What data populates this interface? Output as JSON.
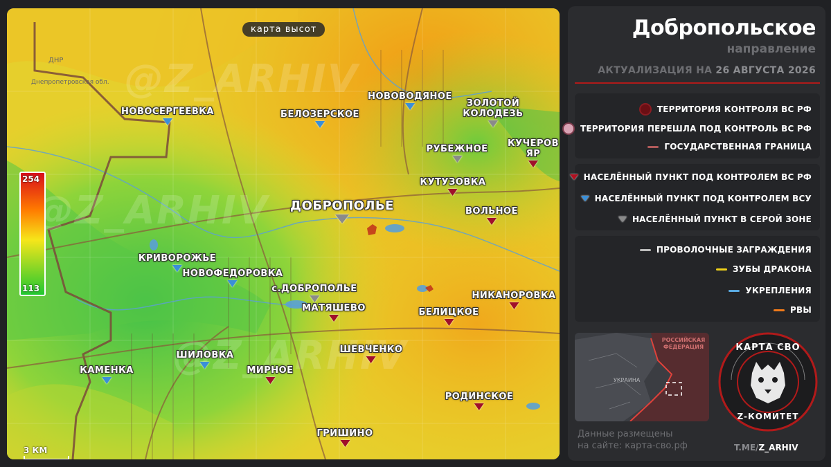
{
  "map": {
    "tag": "карта высот",
    "scale_label": "3 КМ",
    "elevation_max": "254",
    "elevation_min": "113",
    "watermark": "@Z_ARHIV",
    "region_labels": [
      "ДНР",
      "Днепропетровская обл."
    ],
    "towns": [
      {
        "name": "НОВОСЕРГЕЕВКА",
        "status": "blue"
      },
      {
        "name": "БЕЛОЗЕРСКОЕ",
        "status": "blue"
      },
      {
        "name": "НОВОВОДЯНОЕ",
        "status": "blue"
      },
      {
        "name": "ЗОЛОТОЙ КОЛОДЕЗЬ",
        "status": "gray"
      },
      {
        "name": "КУЧЕРОВ ЯР",
        "status": "red"
      },
      {
        "name": "РУБЕЖНОЕ",
        "status": "gray"
      },
      {
        "name": "КУТУЗОВКА",
        "status": "red"
      },
      {
        "name": "ВОЛЬНОЕ",
        "status": "red"
      },
      {
        "name": "ДОБРОПОЛЬЕ",
        "status": "gray"
      },
      {
        "name": "КРИВОРОЖЬЕ",
        "status": "blue"
      },
      {
        "name": "НОВОФЕДОРОВКА",
        "status": "blue"
      },
      {
        "name": "с.ДОБРОПОЛЬЕ",
        "status": "gray"
      },
      {
        "name": "МАТЯШЕВО",
        "status": "red"
      },
      {
        "name": "БЕЛИЦКОЕ",
        "status": "red"
      },
      {
        "name": "НИКАНОРОВКА",
        "status": "red"
      },
      {
        "name": "ШЕВЧЕНКО",
        "status": "red"
      },
      {
        "name": "ШИЛОВКА",
        "status": "blue"
      },
      {
        "name": "КАМЕНКА",
        "status": "blue"
      },
      {
        "name": "МИРНОЕ",
        "status": "red"
      },
      {
        "name": "РОДИНСКОЕ",
        "status": "red"
      },
      {
        "name": "ГРИШИНО",
        "status": "red"
      }
    ]
  },
  "panel": {
    "title": "Добропольское",
    "subtitle": "направление",
    "update_prefix": "АКТУАЛИЗАЦИЯ НА",
    "update_date": "26 АВГУСТА 2026",
    "legend_areas": [
      {
        "label": "ТЕРРИТОРИЯ КОНТРОЛЯ ВС РФ",
        "color": "#6b0f14"
      },
      {
        "label": "ТЕРРИТОРИЯ ПЕРЕШЛА ПОД КОНТРОЛЬ ВС РФ",
        "color": "#d9a3b4"
      },
      {
        "label": "ГОСУДАРСТВЕННАЯ ГРАНИЦА",
        "color": "#b05a5a"
      }
    ],
    "legend_settlements": [
      {
        "label": "НАСЕЛЁННЫЙ ПУНКТ ПОД КОНТРОЛЕМ ВС РФ",
        "color": "#b01020"
      },
      {
        "label": "НАСЕЛЁННЫЙ ПУНКТ ПОД КОНТРОЛЕМ ВСУ",
        "color": "#3a8fd8"
      },
      {
        "label": "НАСЕЛЁННЫЙ ПУНКТ В СЕРОЙ ЗОНЕ",
        "color": "#9a9a9a"
      }
    ],
    "legend_fortifications": [
      {
        "label": "ПРОВОЛОЧНЫЕ ЗАГРАЖДЕНИЯ",
        "color": "#bdbdbd"
      },
      {
        "label": "ЗУБЫ ДРАКОНА",
        "color": "#f0d21a"
      },
      {
        "label": "УКРЕПЛЕНИЯ",
        "color": "#5aa9e0"
      },
      {
        "label": "РВЫ",
        "color": "#f07a1a"
      }
    ],
    "minimap_labels": [
      "РОССИЙСКАЯ ФЕДЕРАЦИЯ",
      "УКРАИНА"
    ],
    "site_line1": "Данные размещены",
    "site_line2": "на сайте: карта-сво.рф",
    "logo_top": "КАРТА СВО",
    "logo_bottom": "Z-КОМИТЕТ",
    "tme_prefix": "T.ME/",
    "tme_handle": "Z_ARHIV"
  }
}
